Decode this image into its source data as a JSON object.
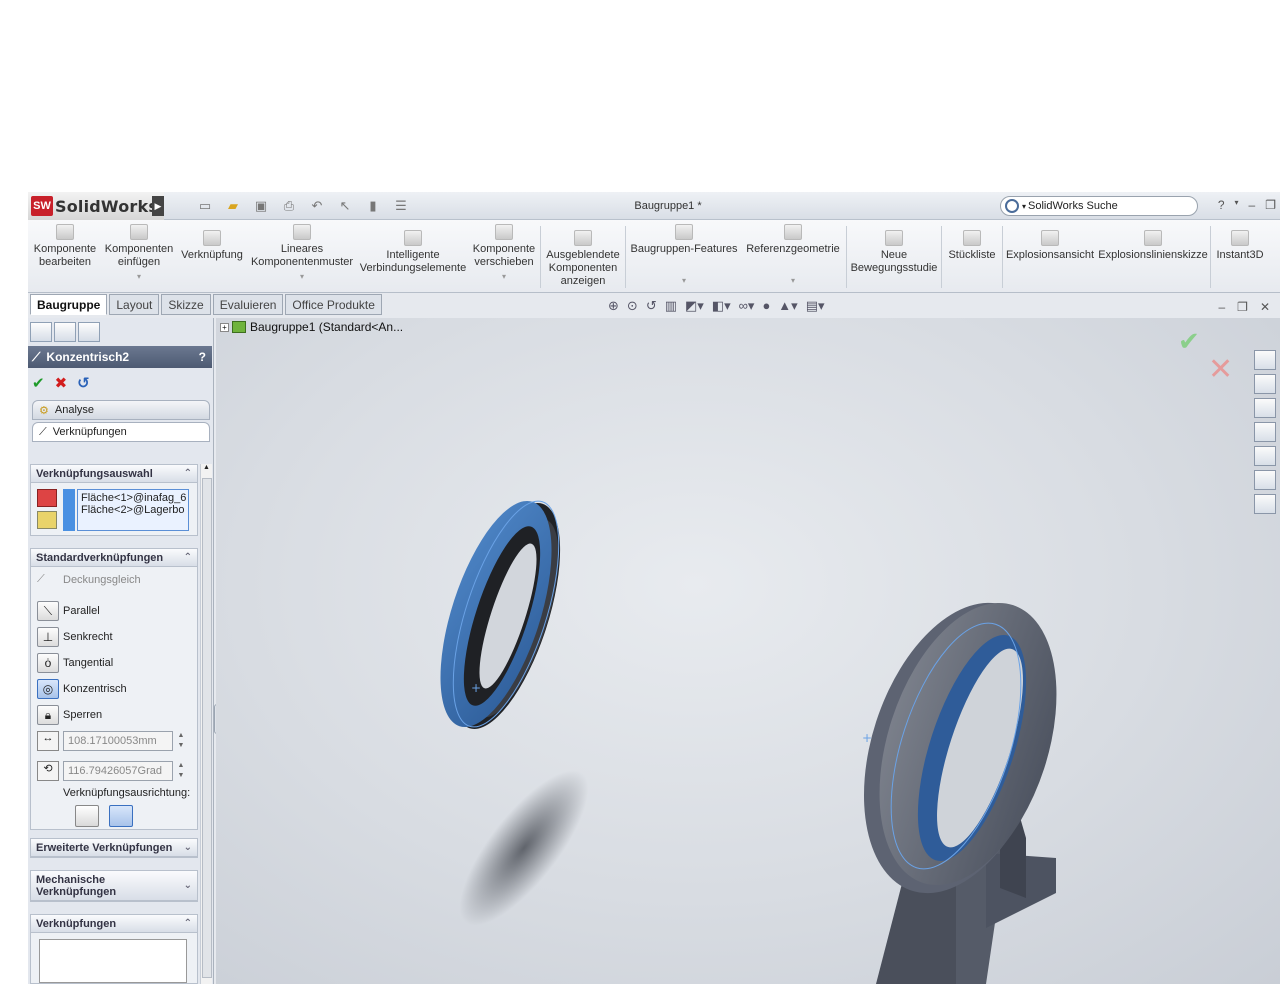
{
  "app": {
    "logo_text": "SolidWorks",
    "document_title": "Baugruppe1 *",
    "search_placeholder": "SolidWorks Suche",
    "help_label": "?"
  },
  "ribbon": {
    "buttons": [
      {
        "label": "Komponente bearbeiten",
        "icon": "edit-component-icon"
      },
      {
        "label": "Komponenten einfügen",
        "icon": "insert-components-icon"
      },
      {
        "label": "Verknüpfung",
        "icon": "mate-icon"
      },
      {
        "label": "Lineares Komponentenmuster",
        "icon": "linear-pattern-icon"
      },
      {
        "label": "Intelligente Verbindungselemente",
        "icon": "smart-fasteners-icon"
      },
      {
        "label": "Komponente verschieben",
        "icon": "move-component-icon"
      },
      {
        "label": "Ausgeblendete Komponenten anzeigen",
        "icon": "show-hidden-icon"
      },
      {
        "label": "Baugruppen-Features",
        "icon": "assembly-features-icon"
      },
      {
        "label": "Referenzgeometrie",
        "icon": "reference-geometry-icon"
      },
      {
        "label": "Neue Bewegungsstudie",
        "icon": "motion-study-icon"
      },
      {
        "label": "Stückliste",
        "icon": "bom-icon"
      },
      {
        "label": "Explosionsansicht",
        "icon": "exploded-view-icon"
      },
      {
        "label": "Explosionslinienskizze",
        "icon": "explode-line-icon"
      },
      {
        "label": "Instant3D",
        "icon": "instant3d-icon"
      }
    ]
  },
  "tabs": [
    "Baugruppe",
    "Layout",
    "Skizze",
    "Evaluieren",
    "Office Produkte"
  ],
  "property_manager": {
    "title": "Konzentrisch2",
    "help": "?",
    "subtabs": [
      "Analyse",
      "Verknüpfungen"
    ],
    "selection_section": {
      "header": "Verknüpfungsauswahl",
      "items": [
        "Fläche<1>@inafag_6",
        "Fläche<2>@Lagerbo"
      ]
    },
    "standard_section": {
      "header": "Standardverknüpfungen",
      "mates": [
        {
          "label": "Deckungsgleich",
          "icon": "coincident-icon"
        },
        {
          "label": "Parallel",
          "icon": "parallel-icon"
        },
        {
          "label": "Senkrecht",
          "icon": "perpendicular-icon"
        },
        {
          "label": "Tangential",
          "icon": "tangent-icon"
        },
        {
          "label": "Konzentrisch",
          "icon": "concentric-icon"
        },
        {
          "label": "Sperren",
          "icon": "lock-icon"
        }
      ],
      "distance_value": "108.17100053mm",
      "angle_value": "116.79426057Grad",
      "alignment_label": "Verknüpfungsausrichtung:"
    },
    "advanced_header": "Erweiterte Verknüpfungen",
    "mechanical_header": "Mechanische Verknüpfungen",
    "mates_header": "Verknüpfungen"
  },
  "graphics": {
    "tree_root": "Baugruppe1  (Standard<An..."
  },
  "colors": {
    "accent_blue": "#3a6fb0",
    "part_gray": "#5b6272",
    "ok_green": "#1f9b2a",
    "cancel_red": "#d21d1d"
  }
}
